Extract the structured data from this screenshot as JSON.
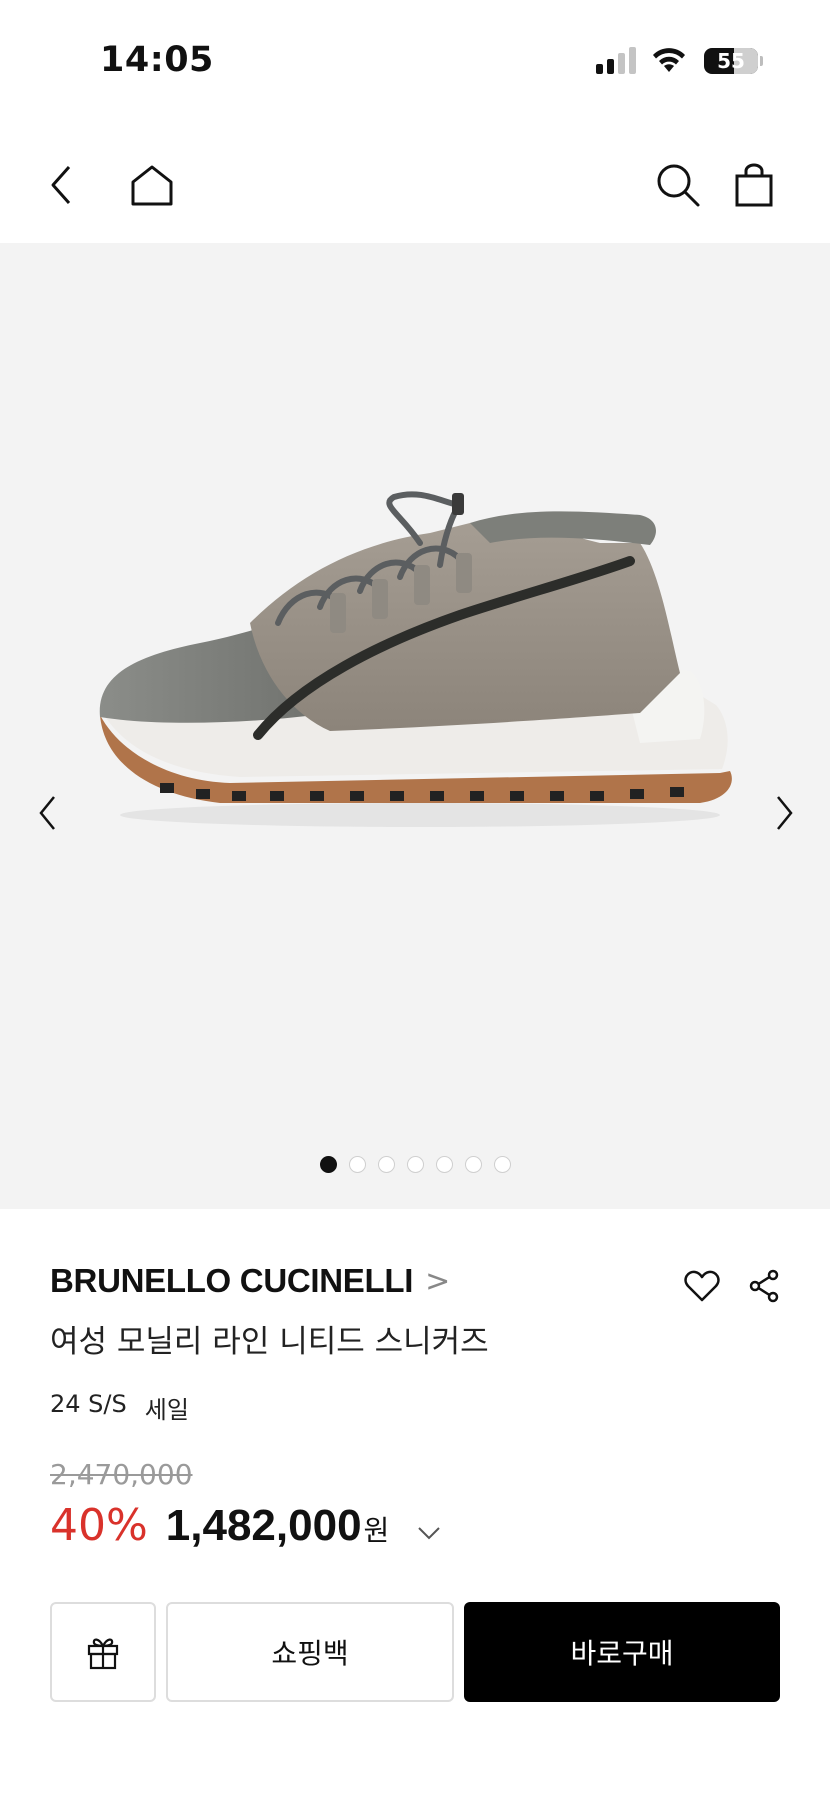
{
  "status_bar": {
    "time": "14:05",
    "battery": "55",
    "battery_level": 55,
    "signal_bars_active": 2,
    "signal_bars_total": 4
  },
  "nav": {
    "icons": [
      "back-icon",
      "home-icon",
      "search-icon",
      "shopping-bag-icon"
    ]
  },
  "gallery": {
    "image": "grey suede knit sneaker with gum sole",
    "total_images": 7,
    "current_index": 1
  },
  "product": {
    "brand": "BRUNELLO CUCINELLI",
    "brand_chevron": ">",
    "name": "여성 모닐리 라인 니티드 스니커즈",
    "season": "24 S/S",
    "sale_tag": "세일",
    "original_price": "2,470,000",
    "discount": "40%",
    "price": "1,482,000",
    "currency": "원"
  },
  "colors": {
    "discount": "#d9322b",
    "buy_button": "#000000",
    "gallery_bg": "#f3f3f3"
  },
  "buttons": {
    "gift_icon": "gift-icon",
    "shopping_bag": "쇼핑백",
    "buy_now": "바로구매"
  }
}
